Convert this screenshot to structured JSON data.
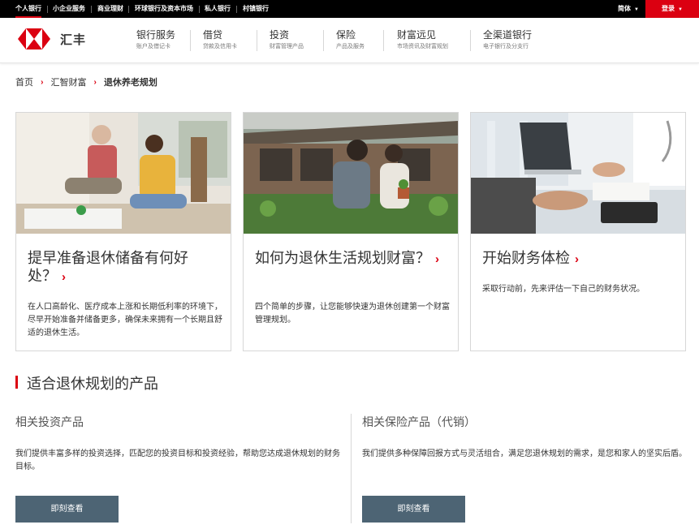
{
  "topbar": {
    "segments": [
      "个人银行",
      "小企业服务",
      "商业理财",
      "环球银行及资本市场",
      "私人银行",
      "村镇银行"
    ],
    "language": "简体",
    "login": "登录"
  },
  "header": {
    "brand": "汇丰",
    "nav": [
      {
        "title": "银行服务",
        "sub": "账户及借记卡"
      },
      {
        "title": "借贷",
        "sub": "贷款及信用卡"
      },
      {
        "title": "投资",
        "sub": "财富管理产品"
      },
      {
        "title": "保险",
        "sub": "产品及服务"
      },
      {
        "title": "财富远见",
        "sub": "市场资讯及财富规划"
      },
      {
        "title": "全渠道银行",
        "sub": "电子银行及分支行"
      }
    ]
  },
  "breadcrumb": [
    "首页",
    "汇智财富",
    "退休养老规划"
  ],
  "cards": [
    {
      "title": "提早准备退休储备有何好处？",
      "desc": "在人口高龄化、医疗成本上涨和长期低利率的环境下，尽早开始准备并储备更多，确保未来拥有一个长期且舒适的退休生活。"
    },
    {
      "title": "如何为退休生活规划财富？",
      "desc": "四个简单的步骤，让您能够快速为退休创建第一个财富管理规划。"
    },
    {
      "title": "开始财务体检",
      "desc": "采取行动前，先来评估一下自己的财务状况。"
    }
  ],
  "section": {
    "title": "适合退休规划的产品",
    "columns": [
      {
        "title": "相关投资产品",
        "desc": "我们提供丰富多样的投资选择，匹配您的投资目标和投资经验，帮助您达成退休规划的财务目标。",
        "button": "即刻查看"
      },
      {
        "title": "相关保险产品（代销）",
        "desc": "我们提供多种保障回报方式与灵活组合，满足您退休规划的需求，是您和家人的坚实后盾。",
        "button": "即刻查看"
      }
    ]
  },
  "colors": {
    "brand_red": "#db0011",
    "button": "#4d6474",
    "topbar": "#000000"
  }
}
